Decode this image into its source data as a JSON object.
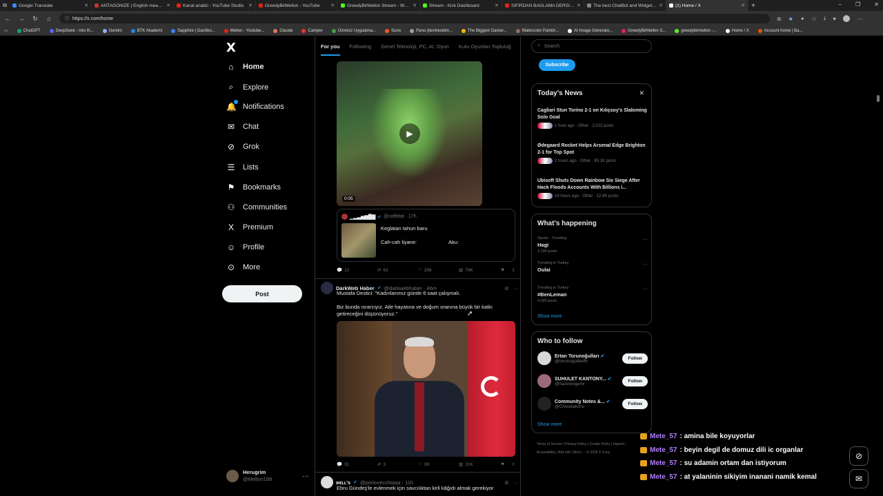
{
  "browser": {
    "tabs": [
      {
        "title": "Google Translate",
        "color": "#4285f4",
        "active": false
      },
      {
        "title": "ANTAGONIZE | English meaning -",
        "color": "#c0392b",
        "active": false
      },
      {
        "title": "Kanal analizi - YouTube Studio",
        "color": "#e62117",
        "active": false
      },
      {
        "title": "GreedyBirMellon - YouTube",
        "color": "#e62117",
        "active": false
      },
      {
        "title": "GreedyBirMellon Stream - Watch",
        "color": "#53fc18",
        "active": false
      },
      {
        "title": "Stream - Kick Dashboard",
        "color": "#53fc18",
        "active": false
      },
      {
        "title": "SIFIRDAN BAĞLAMA DERSİ 3 (EN",
        "color": "#e62117",
        "active": false
      },
      {
        "title": "The best ChatBot and Widgets for",
        "color": "#888888",
        "active": false
      },
      {
        "title": "(1) Home / X",
        "color": "#ffffff",
        "active": true
      }
    ],
    "url": "https://x.com/home",
    "bookmarks": [
      {
        "label": "ChatGPT",
        "color": "#10a37f"
      },
      {
        "label": "DeepSeek - Into th...",
        "color": "#4d6bfe"
      },
      {
        "label": "Gemini",
        "color": "#8ab4f8"
      },
      {
        "label": "BTK Akademi",
        "color": "#1e88e5"
      },
      {
        "label": "Sapphire | Dashbo...",
        "color": "#3b82f6"
      },
      {
        "label": "Mellon - Youtube...",
        "color": "#e62117"
      },
      {
        "label": "Claude",
        "color": "#d97757"
      },
      {
        "label": "Camper",
        "color": "#e53935"
      },
      {
        "label": "Ücretsiz Uygulama...",
        "color": "#43a047"
      },
      {
        "label": "Suno",
        "color": "#ff5722"
      },
      {
        "label": "Pano (bentrendim...",
        "color": "#9e9e9e"
      },
      {
        "label": "The Biggest Gamer...",
        "color": "#ffb300"
      },
      {
        "label": "Watercolor Paintin...",
        "color": "#8d6e63"
      },
      {
        "label": "AI Image Generato...",
        "color": "#ffffff"
      },
      {
        "label": "GreedyBirMellon S...",
        "color": "#e91e63"
      },
      {
        "label": "greedybirmellon -...",
        "color": "#53fc18"
      },
      {
        "label": "Home / X",
        "color": "#ffffff"
      },
      {
        "label": "Account home | Ba...",
        "color": "#e65100"
      }
    ]
  },
  "nav": {
    "logo": "X",
    "items": [
      {
        "label": "Home",
        "icon": "⌂",
        "name": "home"
      },
      {
        "label": "Explore",
        "icon": "⌕",
        "name": "explore"
      },
      {
        "label": "Notifications",
        "icon": "🔔",
        "name": "notifications"
      },
      {
        "label": "Chat",
        "icon": "✉",
        "name": "chat"
      },
      {
        "label": "Grok",
        "icon": "⊘",
        "name": "grok"
      },
      {
        "label": "Lists",
        "icon": "☰",
        "name": "lists"
      },
      {
        "label": "Bookmarks",
        "icon": "⚑",
        "name": "bookmarks"
      },
      {
        "label": "Communities",
        "icon": "⚇",
        "name": "communities"
      },
      {
        "label": "Premium",
        "icon": "X",
        "name": "premium"
      },
      {
        "label": "Profile",
        "icon": "☺",
        "name": "profile"
      },
      {
        "label": "More",
        "icon": "⊙",
        "name": "more"
      }
    ],
    "post_label": "Post",
    "profile": {
      "name": "Herugrim",
      "handle": "@Mellon199"
    }
  },
  "timeline": {
    "tabs": [
      "For you",
      "Following",
      "Genel Teknoloji, PC, AI, Oyun",
      "Kutu Oyunları Topluluğ"
    ],
    "tweet1": {
      "video_time": "0:05",
      "quote_name": "▁▂▃▅▆█▇",
      "quote_handle": "@coffebit · 17h",
      "quote_title": "Keglatan tahun baru",
      "quote_line_left": "Cah-cah liyane:",
      "quote_line_right": "Aku:",
      "replies": "12",
      "reposts": "62",
      "likes": "256",
      "views": "79K"
    },
    "tweet2": {
      "name": "DarkWeb Haber",
      "handle": "@darkwebhaber · 46m",
      "text1": "Mustafa Destici: \"Kadınlarımız günde 6 saat çalışmalı.",
      "text2": "Biz bunda ısrarcıyız. Aile hayatına ve doğum oranına büyük bir katkı getireceğini düşünüyoruz.\"",
      "replies": "31",
      "reposts": "3",
      "likes": "39",
      "views": "21K"
    },
    "tweet3": {
      "name": "ʙᴇʟʟ's",
      "handle": "@portovecchiaaa · 11h",
      "text": "Ebru Gündeş'le evlenmek için savcılıktan kirli kâğıdı almak gerekiyor"
    }
  },
  "right": {
    "search_placeholder": "Search",
    "subscribe": "Subscribe",
    "news_title": "Today's News",
    "news": [
      {
        "title": "Cagliari Stun Torino 2-1 on Kılıçsoy's Slaloming Solo Goal",
        "meta": "1 hour ago · Other · 2,022 posts"
      },
      {
        "title": "Ødegaard Rocket Helps Arsenal Edge Brighton 2-1 for Top Spot",
        "meta": "2 hours ago · Other · 65.1K posts"
      },
      {
        "title": "Ubisoft Shuts Down Rainbow Six Siege After Hack Floods Accounts With Billions i...",
        "meta": "18 hours ago · Other · 12.8K posts"
      }
    ],
    "happening_title": "What's happening",
    "trends": [
      {
        "context": "Sports · Trending",
        "name": "Hagi",
        "posts": "3,196 posts"
      },
      {
        "context": "Trending in Turkey",
        "name": "Oulai",
        "posts": ""
      },
      {
        "context": "Trending in Turkey",
        "name": "#BenLeman",
        "posts": "4,025 posts"
      }
    ],
    "show_more": "Show more",
    "wtf_title": "Who to follow",
    "wtf": [
      {
        "name": "Ertan Torunoğulları",
        "handle": "@torunogullarifb"
      },
      {
        "name": "SUHULET KANTONY...",
        "handle": "@nazeningemi"
      },
      {
        "name": "Community Notes &...",
        "handle": "@CNviolations"
      }
    ],
    "follow_label": "Follow",
    "footer": "Terms of Service  |  Privacy Policy  |  Cookie Policy  |  Imprint  |  Accessibility  |  Ads info  |  More ···  © 2025 X Corp."
  },
  "chat": [
    {
      "user": "Mete_57",
      "msg": ": amina bile koyuyorlar"
    },
    {
      "user": "Mete_57",
      "msg": ": beyin degil de domuz dili ic organlar"
    },
    {
      "user": "Mete_57",
      "msg": ": su adamin ortam dan istiyorum"
    },
    {
      "user": "Mete_57",
      "msg": ": at yalaninin sikiyim inanani namik kemal"
    }
  ]
}
